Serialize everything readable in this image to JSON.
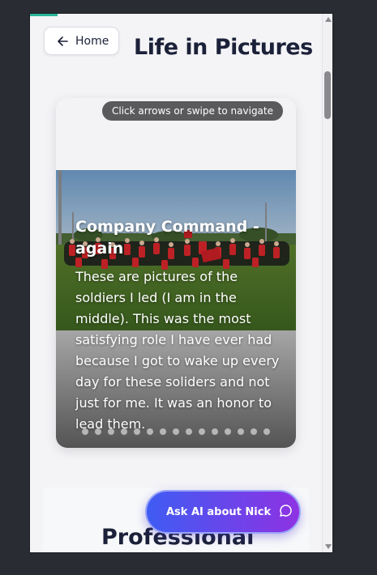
{
  "page": {
    "heading": "Life in Pictures",
    "home_label": "Home"
  },
  "gallery": {
    "hint": "Click arrows or swipe to navigate",
    "current_slide": {
      "title": "Company Command - again",
      "text": "These are pictures of the soldiers I led (I am in the middle). This was the most satisfying role I have ever had because I got to wake up every day for these soliders and not just for me. It was an honor to lead them."
    },
    "dot_count": 15
  },
  "next_section": {
    "title": "Professional"
  },
  "ask_ai": {
    "label": "Ask AI about Nick"
  },
  "colors": {
    "accent": "#2bb59a",
    "heading": "#1b2138",
    "ask_gradient_start": "#3f5cf3",
    "ask_gradient_end": "#8e32e3"
  },
  "icons": {
    "home": "arrow-left-icon",
    "ask": "chat-bubble-icon"
  }
}
